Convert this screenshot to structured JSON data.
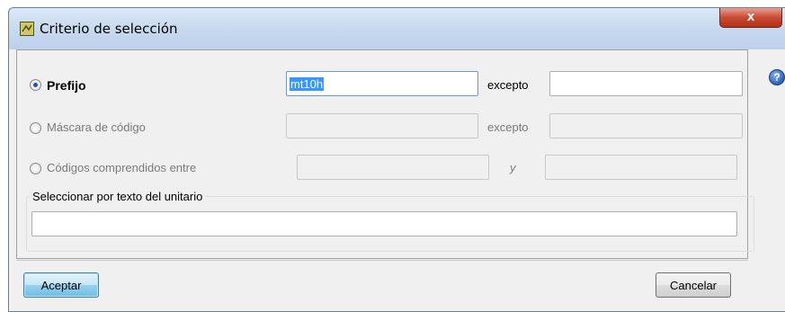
{
  "window": {
    "title": "Criterio de selección",
    "close_glyph": "x"
  },
  "options": {
    "prefijo": {
      "label": "Prefijo",
      "value": "mt10h",
      "except_label": "excepto",
      "except_value": "",
      "selected": true
    },
    "mascara": {
      "label": "Máscara de código",
      "value": "",
      "except_label": "excepto",
      "except_value": "",
      "selected": false
    },
    "codigos": {
      "label": "Códigos comprendidos entre",
      "from_value": "",
      "and_label": "y",
      "to_value": "",
      "selected": false
    }
  },
  "text_group": {
    "legend": "Seleccionar por texto del unitario",
    "value": ""
  },
  "buttons": {
    "accept": "Aceptar",
    "cancel": "Cancelar"
  },
  "help": {
    "glyph": "?"
  },
  "colors": {
    "selection": "#3399ff",
    "titlebar": "#c7d9ef",
    "close": "#c84b33"
  }
}
